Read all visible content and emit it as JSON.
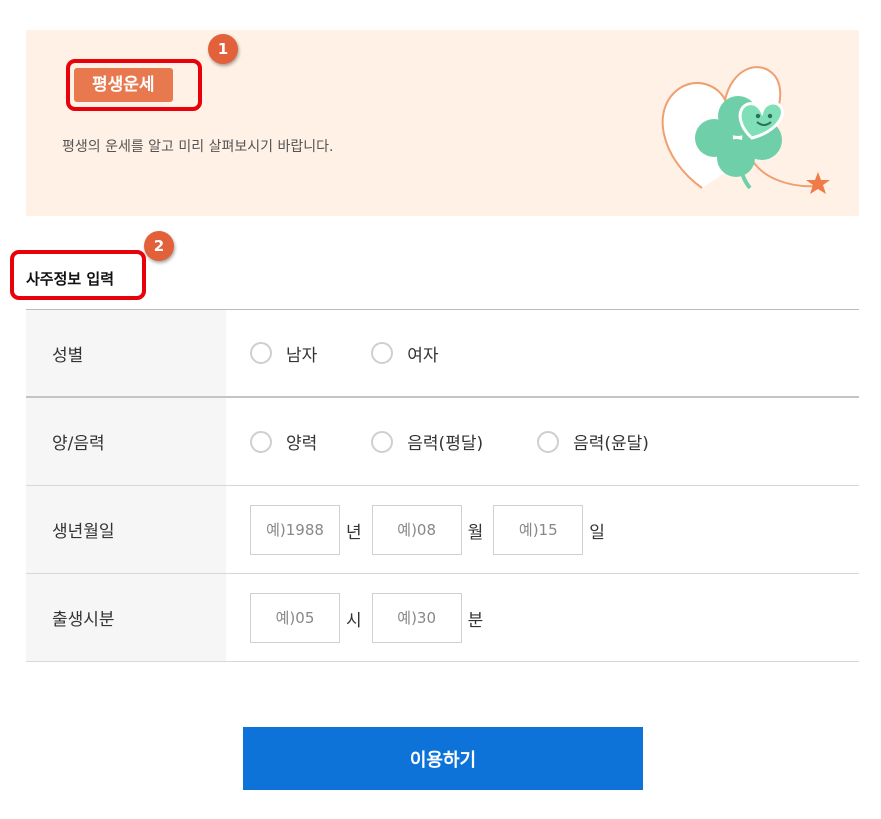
{
  "banner": {
    "title": "평생운세",
    "description": "평생의 운세를 알고 미리 살펴보시기 바랍니다."
  },
  "markers": {
    "step1": "1",
    "step2": "2"
  },
  "section": {
    "title": "사주정보 입력"
  },
  "form": {
    "gender": {
      "label": "성별",
      "options": [
        "남자",
        "여자"
      ]
    },
    "calendar": {
      "label": "양/음력",
      "options": [
        "양력",
        "음력(평달)",
        "음력(윤달)"
      ]
    },
    "birthdate": {
      "label": "생년월일",
      "year_placeholder": "예)1988",
      "year_unit": "년",
      "month_placeholder": "예)08",
      "month_unit": "월",
      "day_placeholder": "예)15",
      "day_unit": "일"
    },
    "birthtime": {
      "label": "출생시분",
      "hour_placeholder": "예)05",
      "hour_unit": "시",
      "minute_placeholder": "예)30",
      "minute_unit": "분"
    }
  },
  "submit": {
    "label": "이용하기"
  },
  "colors": {
    "banner_bg": "#fff1e6",
    "title_badge": "#e8794f",
    "highlight": "#e8000a",
    "marker": "#e2603a",
    "clover": "#6fcfa9",
    "button": "#0d73d9"
  },
  "icons": {
    "banner_illustration": "clover-heart-icon",
    "star": "star-icon"
  }
}
